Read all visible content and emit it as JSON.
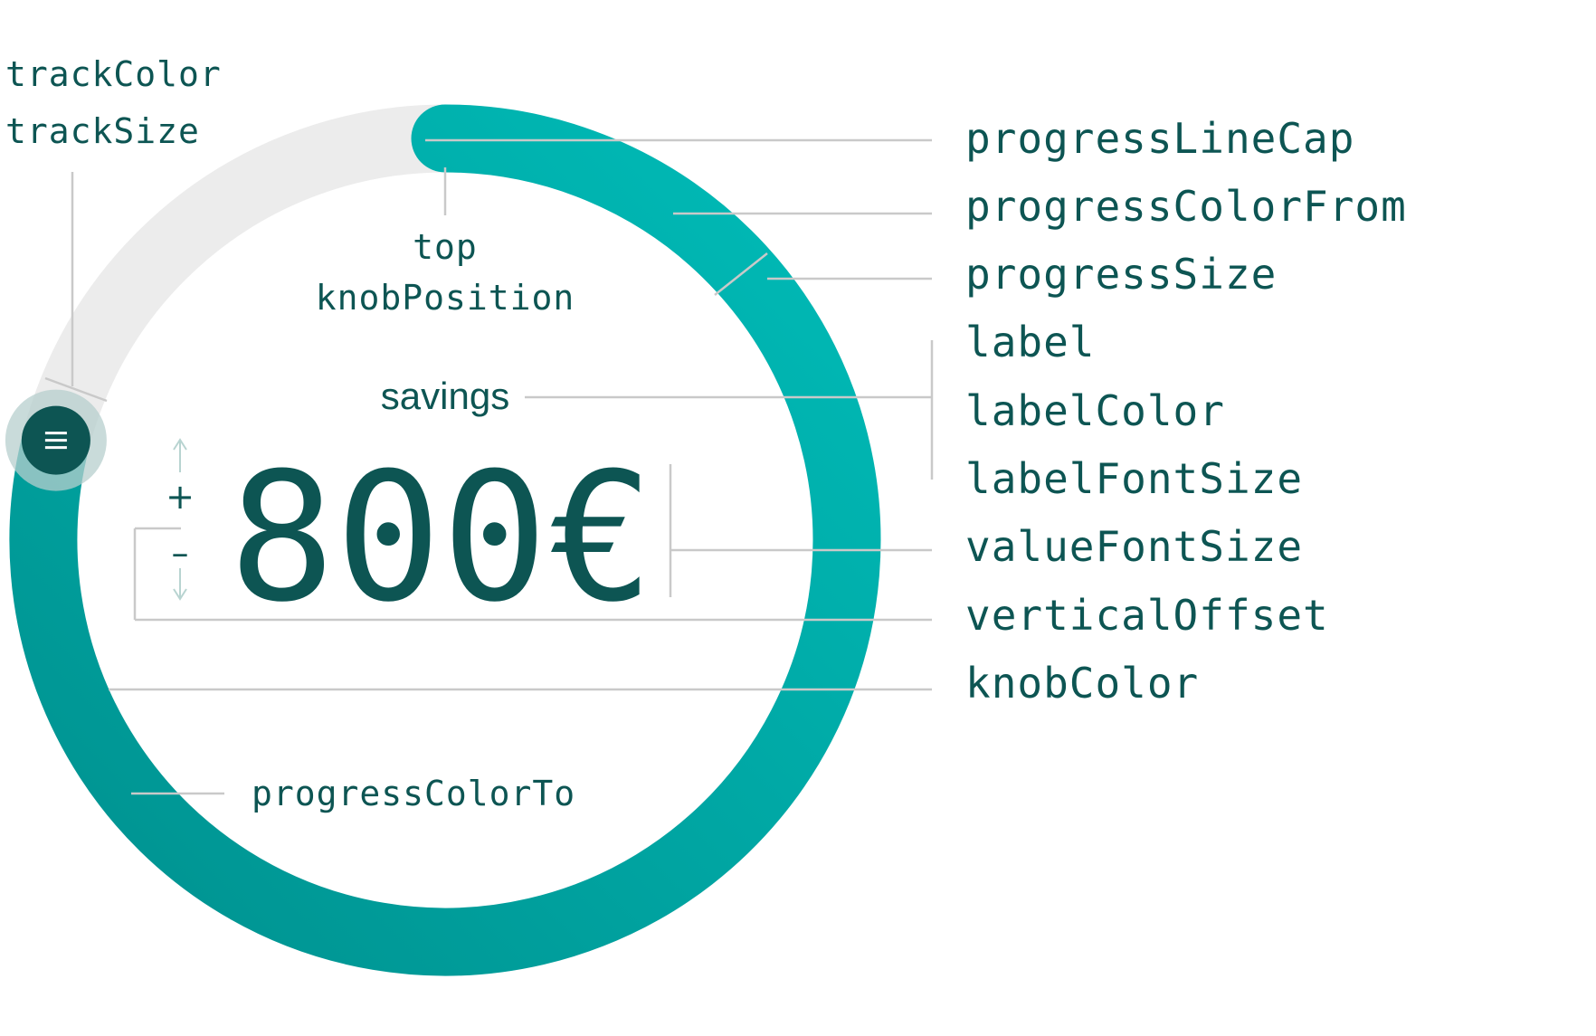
{
  "widget": {
    "label": "savings",
    "value": "800€",
    "progress_fraction": 0.79,
    "knob_icon": "menu-icon",
    "colors": {
      "track": "#ececec",
      "progress_from": "#00bcb8",
      "progress_to": "#00918f",
      "knob": "#0d5553",
      "knob_halo": "#b7cfcd",
      "text": "#0d5553"
    }
  },
  "annotations": {
    "track_color": "trackColor",
    "track_size": "trackSize",
    "knob_position_value": "top",
    "knob_position": "knobPosition",
    "progress_color_to": "progressColorTo",
    "plus_sign": "+",
    "minus_sign": "–",
    "right": [
      "progressLineCap",
      "progressColorFrom",
      "progressSize",
      "label",
      "labelColor",
      "labelFontSize",
      "valueFontSize",
      "verticalOffset",
      "knobColor"
    ]
  }
}
